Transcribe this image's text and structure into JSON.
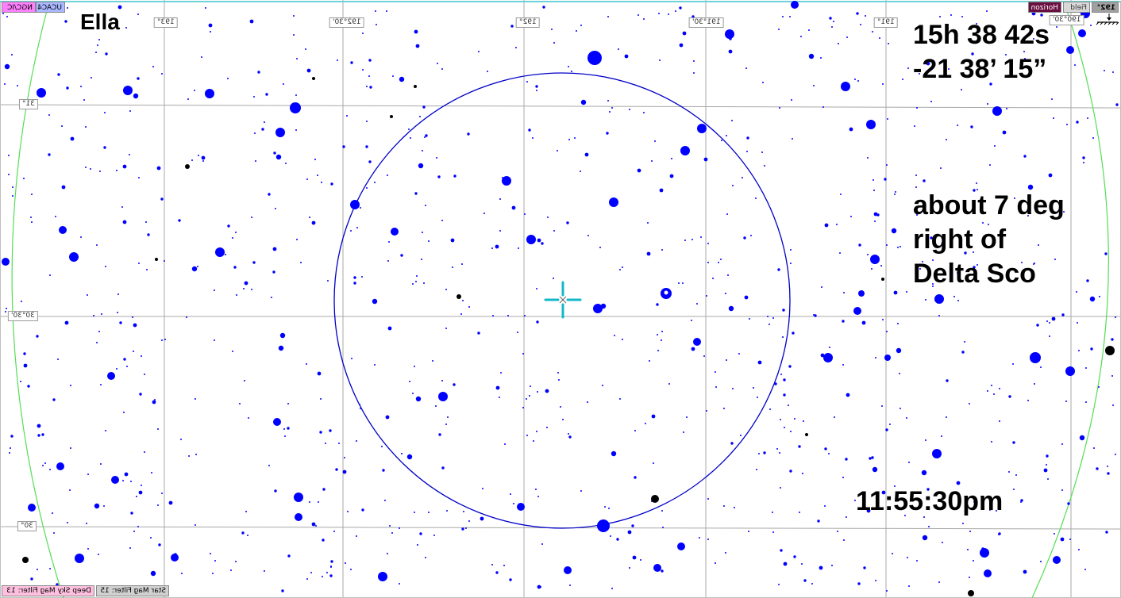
{
  "colors": {
    "star": "#0000ff",
    "deep_sky_object": "#000000",
    "fov_circle": "#0000c8",
    "horizon_line": "#55dd55",
    "grid": "#a8a8a8",
    "reticle": "#10b8c8",
    "toolbar_ngc": "#ff80ff",
    "toolbar_ucac": "#aab8ff",
    "toolbar_horizon": "#6a1040",
    "toolbar_field": "#d8d8d8",
    "toolbar_center": "#a0a0a0",
    "status_deepsky": "#ffc0e0",
    "status_starmag": "#d0d0d0"
  },
  "annotations": {
    "name": "Ella",
    "ra": "15h 38 42s",
    "dec": "-21 38’ 15”",
    "note_line1": "about 7 deg",
    "note_line2": "right of",
    "note_line3": "Delta Sco",
    "time": "11:55:30pm"
  },
  "toolbar": {
    "ngc_ic_label": "NGC/IC",
    "ucac4_label": "UCAC4",
    "horizon_label": "Horizon",
    "field_label": "Field",
    "center_label": "192°",
    "compass_icon": "compass-icon"
  },
  "grid_labels": {
    "ra": [
      "193°",
      "192°30'",
      "192°",
      "191°30'",
      "191°",
      "190°30'"
    ],
    "dec": [
      "31°",
      "30°30'",
      "30°"
    ]
  },
  "status_bar": {
    "deep_sky_filter": "Deep Sky Mag Filter: 13",
    "star_filter": "Star Mag Filter: 15"
  }
}
